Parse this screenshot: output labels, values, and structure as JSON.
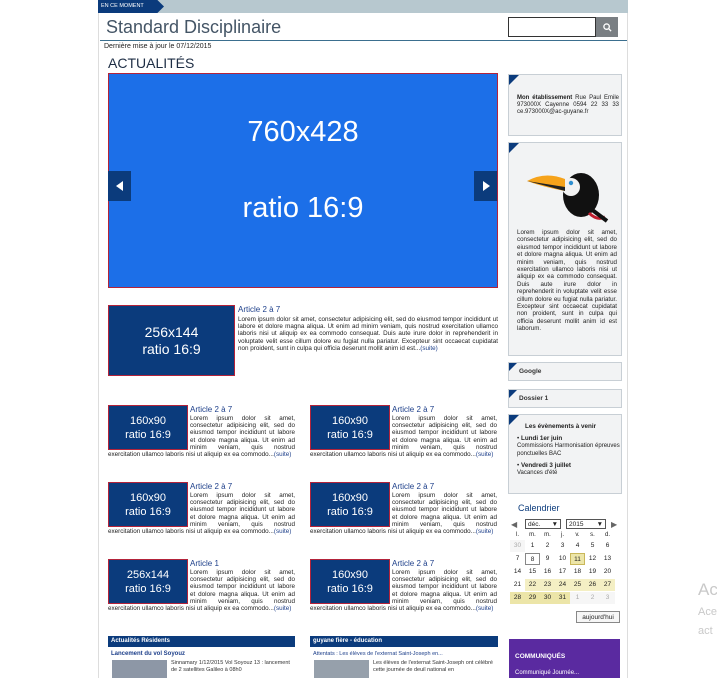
{
  "header": {
    "ticker_label": "EN CE MOMENT",
    "site_title": "Standard Disciplinaire",
    "last_update": "Dernière mise à jour le 07/12/2015",
    "search_placeholder": ""
  },
  "section_title": "ACTUALITÉS",
  "slider": {
    "line1": "760x428",
    "line2": "ratio 16:9"
  },
  "lead": {
    "ph1": "256x144",
    "ph2": "ratio 16:9",
    "title": "Article 2 à 7",
    "text": "Lorem ipsum dolor sit amet, consectetur adipisicing elit, sed do eiusmod tempor incididunt ut labore et dolore magna aliqua. Ut enim ad minim veniam, quis nostrud exercitation ullamco laboris nisi ut aliquip ex ea commodo consequat. Duis aute irure dolor in reprehenderit in voluptate velit esse cillum dolore eu fugiat nulla pariatur. Excepteur sint occaecat cupidatat non proident, sunt in culpa qui officia deserunt mollit anim id est...",
    "more": "(suite)"
  },
  "articles": [
    {
      "ph1": "160x90",
      "ph2": "ratio 16:9",
      "title": "Article 2 à 7",
      "text": "Lorem ipsum dolor sit amet, consectetur adipisicing elit, sed do eiusmod tempor incididunt ut labore et dolore magna aliqua. Ut enim ad minim veniam, quis nostrud exercitation ullamco laboris nisi ut aliquip ex ea commodo...",
      "more": "(suite)"
    },
    {
      "ph1": "160x90",
      "ph2": "ratio 16:9",
      "title": "Article 2 à 7",
      "text": "Lorem ipsum dolor sit amet, consectetur adipisicing elit, sed do eiusmod tempor incididunt ut labore et dolore magna aliqua. Ut enim ad minim veniam, quis nostrud exercitation ullamco laboris nisi ut aliquip ex ea commodo...",
      "more": "(suite)"
    },
    {
      "ph1": "160x90",
      "ph2": "ratio 16:9",
      "title": "Article 2 à 7",
      "text": "Lorem ipsum dolor sit amet, consectetur adipisicing elit, sed do eiusmod tempor incididunt ut labore et dolore magna aliqua. Ut enim ad minim veniam, quis nostrud exercitation ullamco laboris nisi ut aliquip ex ea commodo...",
      "more": "(suite)"
    },
    {
      "ph1": "160x90",
      "ph2": "ratio 16:9",
      "title": "Article 2 à 7",
      "text": "Lorem ipsum dolor sit amet, consectetur adipisicing elit, sed do eiusmod tempor incididunt ut labore et dolore magna aliqua. Ut enim ad minim veniam, quis nostrud exercitation ullamco laboris nisi ut aliquip ex ea commodo...",
      "more": "(suite)"
    },
    {
      "ph1": "256x144",
      "ph2": "ratio 16:9",
      "title": "Article 1",
      "text": "Lorem ipsum dolor sit amet, consectetur adipisicing elit, sed do eiusmod tempor incididunt ut labore et dolore magna aliqua. Ut enim ad minim veniam, quis nostrud exercitation ullamco laboris nisi ut aliquip ex ea commodo...",
      "more": "(suite)"
    },
    {
      "ph1": "160x90",
      "ph2": "ratio 16:9",
      "title": "Article 2 à 7",
      "text": "Lorem ipsum dolor sit amet, consectetur adipisicing elit, sed do eiusmod tempor incididunt ut labore et dolore magna aliqua. Ut enim ad minim veniam, quis nostrud exercitation ullamco laboris nisi ut aliquip ex ea commodo...",
      "more": "(suite)"
    }
  ],
  "feeds": [
    {
      "header": "Actualités Résidents",
      "item_title": "Lancement du vol Soyouz",
      "item_text": "Sinnamary 1/12/2015 Vol Soyouz 13 : lancement de 2 satellites Galileo à 08h0"
    },
    {
      "header": "guyane fière - éducation",
      "item_title": "Attentats : Les élèves de l'externat Saint-Joseph en...",
      "item_text": "Les élèves de l'externat Saint-Joseph ont célébré cette journée de deuil national en"
    }
  ],
  "sidebar": {
    "address_label": "Mon établissement",
    "address_text": "Rue Paul Emile 973000X Cayenne 0594 22 33 33 ce.973000X@ac-guyane.fr",
    "bird_text": "Lorem ipsum dolor sit amet, consectetur adipisicing elit, sed do eiusmod tempor incididunt ut labore et dolore magna aliqua. Ut enim ad minim veniam, quis nostrud exercitation ullamco laboris nisi ut aliquip ex ea commodo consequat. Duis aute irure dolor in reprehenderit in voluptate velit esse cillum dolore eu fugiat nulla pariatur. Excepteur sint occaecat cupidatat non proident, sunt in culpa qui officia deserunt mollit anim id est laborum.",
    "google_label": "Google",
    "dossier_label": "Dossier 1",
    "events_title": "Les évènements à venir",
    "events": [
      {
        "date": "Lundi 1er juin",
        "text": "Commissions Harmonisation épreuves ponctuelles BAC"
      },
      {
        "date": "Vendredi 3 juillet",
        "text": "Vacances d'été"
      }
    ],
    "calendar": {
      "title": "Calendrier",
      "month": "déc.",
      "year": "2015",
      "day_headers": [
        "l.",
        "m.",
        "m.",
        "j.",
        "v.",
        "s.",
        "d."
      ],
      "weeks": [
        [
          "30",
          "1",
          "2",
          "3",
          "4",
          "5",
          "6"
        ],
        [
          "7",
          "8",
          "9",
          "10",
          "11",
          "12",
          "13"
        ],
        [
          "14",
          "15",
          "16",
          "17",
          "18",
          "19",
          "20"
        ],
        [
          "21",
          "22",
          "23",
          "24",
          "25",
          "26",
          "27"
        ],
        [
          "28",
          "29",
          "30",
          "31",
          "1",
          "2",
          "3"
        ]
      ],
      "today_label": "aujourd'hui"
    },
    "communiques_title": "COMMUNIQUÉS",
    "communiques_item": "Communiqué Journée..."
  },
  "overlay": {
    "line1": "Ac",
    "line2": "Ace",
    "line3": "act"
  },
  "colors": {
    "brand_blue": "#0b3b7c",
    "slider_blue": "#1c6fe8",
    "accent_red": "#b3233a",
    "header_gray": "#b7c8cf",
    "purple": "#5a2aa0",
    "gold": "#ece5a8"
  }
}
